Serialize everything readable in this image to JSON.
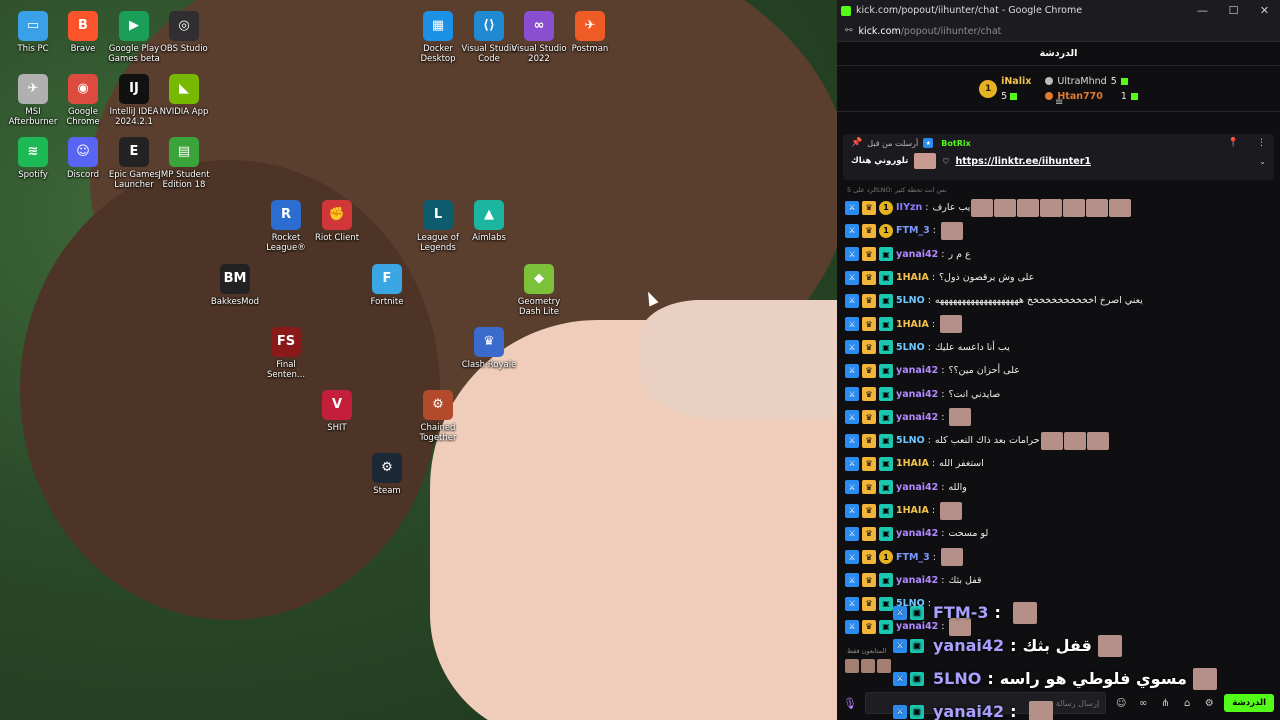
{
  "desktop_icons": [
    {
      "label": "This PC",
      "bg": "#3aa0e8",
      "glyph": "▭"
    },
    {
      "label": "Brave",
      "bg": "#fb542b",
      "glyph": "B"
    },
    {
      "label": "Google Play Games beta",
      "bg": "#1a9e58",
      "glyph": "▶"
    },
    {
      "label": "OBS Studio",
      "bg": "#302e31",
      "glyph": "◎"
    },
    {
      "label": "Docker Desktop",
      "bg": "#1d91e6",
      "glyph": "▦"
    },
    {
      "label": "Visual Studio Code",
      "bg": "#1f8ad2",
      "glyph": "⟨⟩"
    },
    {
      "label": "Visual Studio 2022",
      "bg": "#8a4fd1",
      "glyph": "∞"
    },
    {
      "label": "Postman",
      "bg": "#ef5b25",
      "glyph": "✈"
    },
    {
      "label": "MSI Afterburner",
      "bg": "#b0b0b0",
      "glyph": "✈"
    },
    {
      "label": "Google Chrome",
      "bg": "#dd4b3e",
      "glyph": "◉"
    },
    {
      "label": "IntelliJ IDEA 2024.2.1",
      "bg": "#111",
      "glyph": "IJ"
    },
    {
      "label": "NVIDIA App",
      "bg": "#76b900",
      "glyph": "◣"
    },
    {
      "label": "Spotify",
      "bg": "#1db954",
      "glyph": "≋"
    },
    {
      "label": "Discord",
      "bg": "#5865f2",
      "glyph": "☺"
    },
    {
      "label": "Epic Games Launcher",
      "bg": "#222",
      "glyph": "E"
    },
    {
      "label": "JMP Student Edition 18",
      "bg": "#3aa33a",
      "glyph": "▤"
    },
    {
      "label": "Rocket League®",
      "bg": "#2c6dd2",
      "glyph": "R"
    },
    {
      "label": "Riot Client",
      "bg": "#d13639",
      "glyph": "✊"
    },
    {
      "label": "League of Legends",
      "bg": "#0d5c6e",
      "glyph": "L"
    },
    {
      "label": "Aimlabs",
      "bg": "#1bb5a0",
      "glyph": "▲"
    },
    {
      "label": "BakkesMod",
      "bg": "#222",
      "glyph": "BM"
    },
    {
      "label": "Fortnite",
      "bg": "#3aa6e4",
      "glyph": "F"
    },
    {
      "label": "Geometry Dash Lite",
      "bg": "#7bc23a",
      "glyph": "◆"
    },
    {
      "label": "Final Senten...",
      "bg": "#8a1a1a",
      "glyph": "FS"
    },
    {
      "label": "Clash Royale",
      "bg": "#3a6acb",
      "glyph": "♛"
    },
    {
      "label": "SHIT",
      "bg": "#c41f3a",
      "glyph": "V"
    },
    {
      "label": "Chained Together",
      "bg": "#b34a2c",
      "glyph": "⚙"
    },
    {
      "label": "Steam",
      "bg": "#1b2838",
      "glyph": "⚙"
    }
  ],
  "window": {
    "title": "kick.com/popout/iihunter/chat - Google Chrome",
    "url_host": "kick.com",
    "url_path": "/popout/iihunter/chat",
    "chat_title": "الدردشة"
  },
  "leaderboard": {
    "first": {
      "rank": "1",
      "name": "iNalix",
      "count": "5"
    },
    "others": [
      {
        "name": "UltraMhnd",
        "count": "5",
        "color": "#bbbbbb"
      },
      {
        "name": "Htan770",
        "count": "1",
        "color": "#e07b30"
      }
    ]
  },
  "pinned": {
    "label": "أرسلت من قبل",
    "bot": "BotRix",
    "text": "تلوروني هناك",
    "link": "https://linktr.ee/iihunter1"
  },
  "reply_hint": "الرد على 5LNO: بس انت تحطه كثير",
  "messages": [
    {
      "user": "IIYzn",
      "color": "#8b7dff",
      "coin": "1",
      "text": "يب عارف",
      "emotes": 7
    },
    {
      "user": "FTM_3",
      "color": "#7c9bff",
      "coin": "1",
      "text": "",
      "emotes": 1
    },
    {
      "user": "yanai42",
      "color": "#b488ff",
      "coin": "",
      "text": "ع م ر",
      "emotes": 0
    },
    {
      "user": "1HAIA",
      "color": "#f4c34d",
      "coin": "",
      "text": "على وش يرقصون ذول؟",
      "emotes": 0
    },
    {
      "user": "5LNO",
      "color": "#6ec7ff",
      "coin": "",
      "text": "يعني اصرخ اخخخخخخخخخخخ هههههههههههههههههههه",
      "emotes": 0
    },
    {
      "user": "1HAIA",
      "color": "#f4c34d",
      "coin": "",
      "text": "",
      "emotes": 1
    },
    {
      "user": "5LNO",
      "color": "#6ec7ff",
      "coin": "",
      "text": "يب أنا داعسه عليك",
      "emotes": 0
    },
    {
      "user": "yanai42",
      "color": "#b488ff",
      "coin": "",
      "text": "على أحزان مين؟؟",
      "emotes": 0
    },
    {
      "user": "yanai42",
      "color": "#b488ff",
      "coin": "",
      "text": "صايدني انت؟",
      "emotes": 0
    },
    {
      "user": "yanai42",
      "color": "#b488ff",
      "coin": "",
      "text": "",
      "emotes": 1
    },
    {
      "user": "5LNO",
      "color": "#6ec7ff",
      "coin": "",
      "text": "حرامات بعد ذاك التعب كله",
      "emotes": 3
    },
    {
      "user": "1HAIA",
      "color": "#f4c34d",
      "coin": "",
      "text": "استغفر الله",
      "emotes": 0
    },
    {
      "user": "yanai42",
      "color": "#b488ff",
      "coin": "",
      "text": "والله",
      "emotes": 0
    },
    {
      "user": "1HAIA",
      "color": "#f4c34d",
      "coin": "",
      "text": "",
      "emotes": 1
    },
    {
      "user": "yanai42",
      "color": "#b488ff",
      "coin": "",
      "text": "لو مسحت",
      "emotes": 0
    },
    {
      "user": "FTM_3",
      "color": "#7c9bff",
      "coin": "1",
      "text": "",
      "emotes": 1
    },
    {
      "user": "yanai42",
      "color": "#b488ff",
      "coin": "",
      "text": "قفل بثك",
      "emotes": 0
    },
    {
      "user": "5LNO",
      "color": "#6ec7ff",
      "coin": "",
      "text": "",
      "emotes": 0
    },
    {
      "user": "yanai42",
      "color": "#b488ff",
      "coin": "",
      "text": "",
      "emotes": 1
    }
  ],
  "overlay": [
    {
      "user": "FTM-3",
      "text": ""
    },
    {
      "user": "yanai42",
      "text": "قفل بثك"
    },
    {
      "user": "5LNO",
      "text": "مسوي فلوطي هو راسه"
    },
    {
      "user": "yanai42",
      "text": ""
    }
  ],
  "followers_only": "المتابعون فقط",
  "input": {
    "placeholder": "إرسال رسالة",
    "send_label": "الدردشة"
  }
}
